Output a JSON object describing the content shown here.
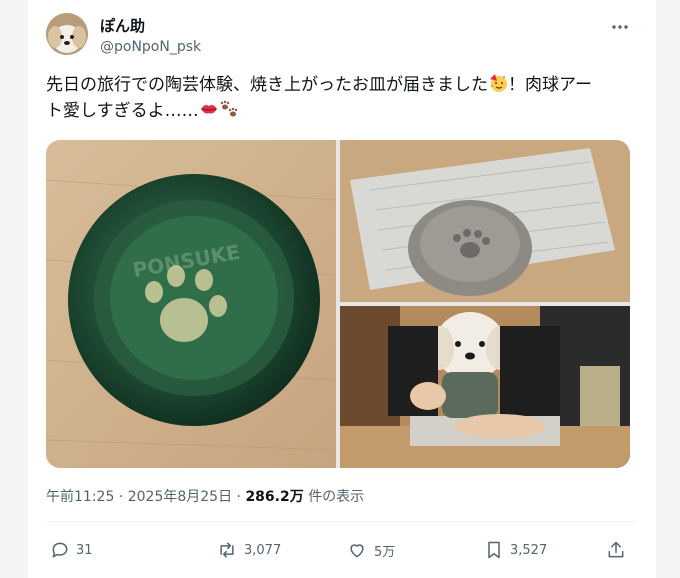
{
  "user": {
    "display_name": "ぽん助",
    "handle": "@poNpoN_psk"
  },
  "post": {
    "text_line1": "先日の旅行での陶芸体験、焼き上がったお皿が届きました",
    "text_line1_end": "！肉球アー",
    "text_line2": "ト愛しすぎるよ……"
  },
  "media": {
    "dish_text": "PONSUKE"
  },
  "meta": {
    "time": "午前11:25",
    "date": "2025年8月25日",
    "views_count": "286.2万",
    "views_label": "件の表示"
  },
  "actions": {
    "replies": "31",
    "reposts": "3,077",
    "likes": "5万",
    "bookmarks": "3,527"
  },
  "icons": {
    "more": "more-icon",
    "reply": "reply-icon",
    "repost": "repost-icon",
    "like": "heart-icon",
    "bookmark": "bookmark-icon",
    "share": "share-icon"
  },
  "colors": {
    "text": "#0f1419",
    "secondary": "#536471"
  }
}
